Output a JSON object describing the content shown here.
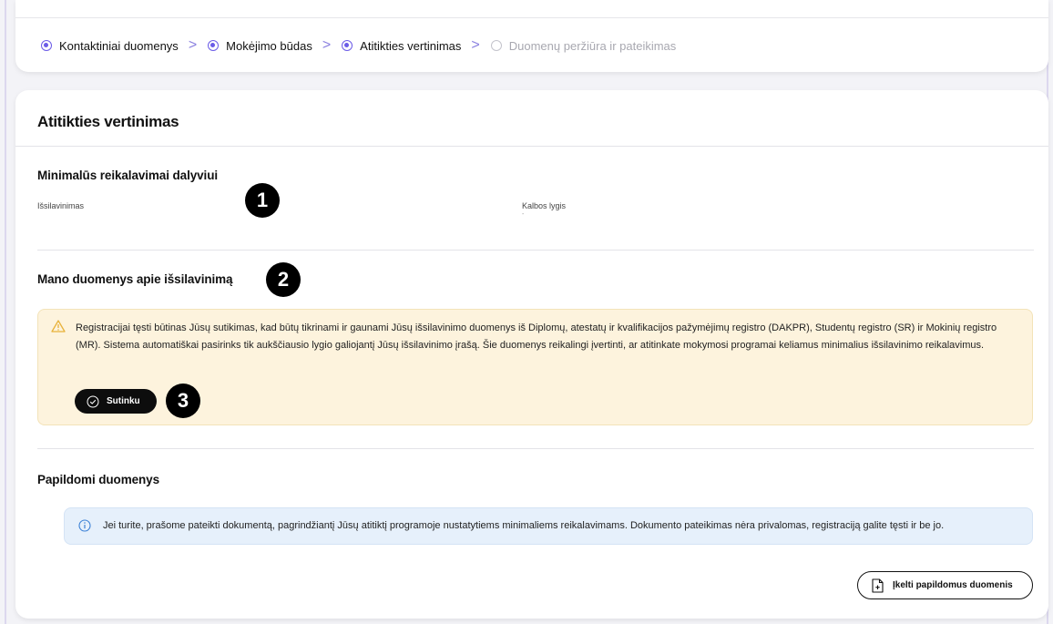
{
  "stepper": {
    "steps": [
      {
        "label": "Kontaktiniai duomenys",
        "state": "done"
      },
      {
        "label": "Mokėjimo būdas",
        "state": "done"
      },
      {
        "label": "Atitikties vertinimas",
        "state": "current"
      },
      {
        "label": "Duomenų peržiūra ir pateikimas",
        "state": "todo"
      }
    ]
  },
  "main": {
    "title": "Atitikties vertinimas",
    "min_requirements": {
      "title": "Minimalūs reikalavimai dalyviui",
      "education_label": "Išsilavinimas",
      "education_value": "",
      "language_label": "Kalbos lygis",
      "language_value": "-"
    },
    "my_education": {
      "title": "Mano duomenys apie išsilavinimą",
      "warning_text": "Registracijai tęsti būtinas Jūsų sutikimas, kad būtų tikrinami ir gaunami Jūsų išsilavinimo duomenys iš Diplomų, atestatų ir kvalifikacijos pažymėjimų registro (DAKPR), Studentų registro (SR) ir Mokinių registro (MR). Sistema automatiškai pasirinks tik aukščiausio lygio galiojantį Jūsų išsilavinimo įrašą. Šie duomenys reikalingi įvertinti, ar atitinkate mokymosi programai keliamus minimalius išsilavinimo reikalavimus.",
      "agree_label": "Sutinku"
    },
    "additional": {
      "title": "Papildomi duomenys",
      "info_text": "Jei turite, prašome pateikti dokumentą, pagrindžiantį Jūsų atitiktį programoje nustatytiems minimaliems reikalavimams. Dokumento pateikimas nėra privalomas, registraciją galite tęsti ir be jo.",
      "upload_label": "Įkelti papildomus duomenis"
    }
  },
  "annotations": [
    "1",
    "2",
    "3"
  ],
  "colors": {
    "accent": "#6b5ce7",
    "warning_bg": "#fdf3dd",
    "info_bg": "#e6f0fb"
  }
}
